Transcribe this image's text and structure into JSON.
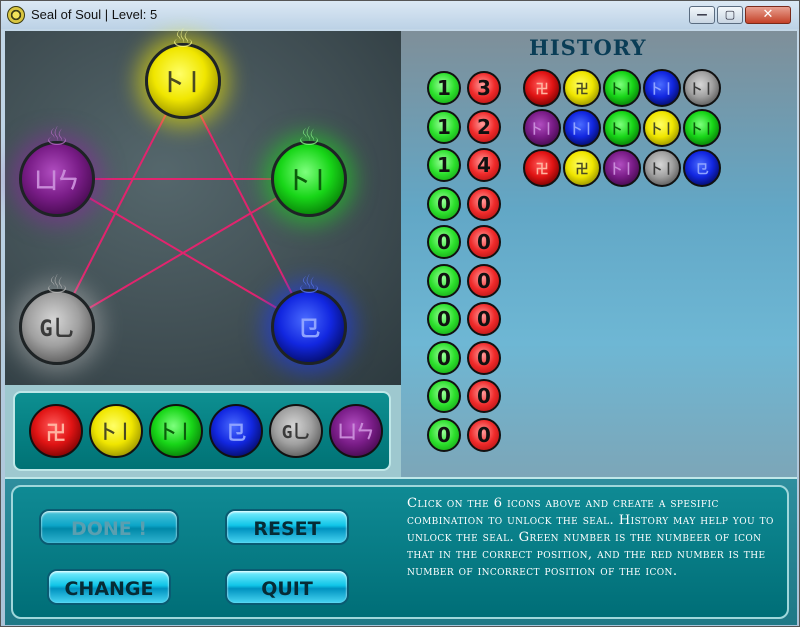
{
  "window": {
    "title": "Seal of Soul | Level: 5",
    "buttons": {
      "minimize": "—",
      "maximize": "▢",
      "close": "✕"
    }
  },
  "seal": {
    "orbs": [
      {
        "color": "yellow",
        "rune": "卜丨",
        "flame": "♨"
      },
      {
        "color": "green",
        "rune": "卜丨",
        "flame": "♨"
      },
      {
        "color": "purple",
        "rune": "凵ㄣ",
        "flame": "♨"
      },
      {
        "color": "gray",
        "rune": "G乚",
        "flame": "♨"
      },
      {
        "color": "blue",
        "rune": "㔾",
        "flame": "♨"
      }
    ],
    "pentagram_color": "#e2246e"
  },
  "tray": [
    {
      "color": "red",
      "rune": "卍"
    },
    {
      "color": "yellow",
      "rune": "卜丨"
    },
    {
      "color": "green",
      "rune": "卜丨"
    },
    {
      "color": "blue",
      "rune": "㔾"
    },
    {
      "color": "gray",
      "rune": "G乚"
    },
    {
      "color": "purple",
      "rune": "凵ㄣ"
    }
  ],
  "scores": [
    {
      "correct": "1",
      "incorrect": "3"
    },
    {
      "correct": "1",
      "incorrect": "2"
    },
    {
      "correct": "1",
      "incorrect": "4"
    },
    {
      "correct": "0",
      "incorrect": "0"
    },
    {
      "correct": "0",
      "incorrect": "0"
    },
    {
      "correct": "0",
      "incorrect": "0"
    },
    {
      "correct": "0",
      "incorrect": "0"
    },
    {
      "correct": "0",
      "incorrect": "0"
    },
    {
      "correct": "0",
      "incorrect": "0"
    },
    {
      "correct": "0",
      "incorrect": "0"
    }
  ],
  "history": {
    "title": "HISTORY",
    "rows": [
      [
        {
          "color": "red",
          "rune": "卍"
        },
        {
          "color": "yellow",
          "rune": "卍"
        },
        {
          "color": "green",
          "rune": "卜丨"
        },
        {
          "color": "blue",
          "rune": "卜丨"
        },
        {
          "color": "gray",
          "rune": "卜丨"
        }
      ],
      [
        {
          "color": "purple",
          "rune": "卜丨"
        },
        {
          "color": "blue",
          "rune": "卜丨"
        },
        {
          "color": "green",
          "rune": "卜丨"
        },
        {
          "color": "yellow",
          "rune": "卜丨"
        },
        {
          "color": "green",
          "rune": "卜丨"
        }
      ],
      [
        {
          "color": "red",
          "rune": "卍"
        },
        {
          "color": "yellow",
          "rune": "卍"
        },
        {
          "color": "purple",
          "rune": "卜丨"
        },
        {
          "color": "gray",
          "rune": "卜丨"
        },
        {
          "color": "blue",
          "rune": "㔾"
        }
      ]
    ]
  },
  "controls": {
    "done": "DONE !",
    "reset": "RESET",
    "change": "CHANGE",
    "quit": "QUIT"
  },
  "help": "Click on the 6 icons above and create a spesific combination to unlock the seal. History may help you to unlock the seal. Green number is the numbeer of icon that in the correct position, and the red number is the number of incorrect position of the icon."
}
